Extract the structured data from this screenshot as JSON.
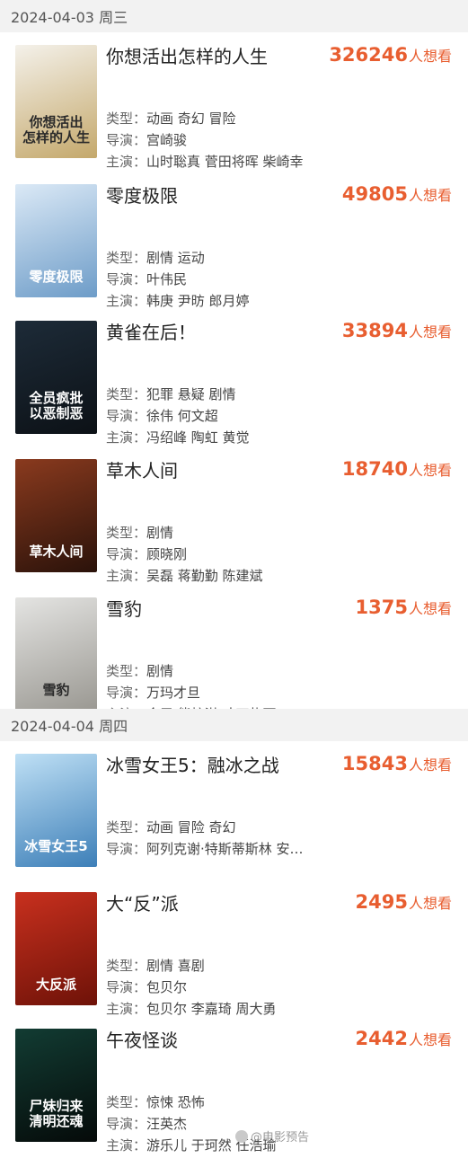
{
  "sections": [
    {
      "date": "2024-04-03 周三",
      "movies": [
        {
          "title": "你想活出怎样的人生",
          "wish_count": "326246",
          "wish_label": "人想看",
          "type_label": "类型：",
          "type": "动画 奇幻 冒险",
          "director_label": "导演：",
          "director": "宫崎骏",
          "cast_label": "主演：",
          "cast": "山时聡真 菅田将晖 柴崎幸",
          "poster_colors": [
            "#f4f1ea",
            "#c4a86b"
          ],
          "poster_text": "你想活出\n怎样的人生"
        },
        {
          "title": "零度极限",
          "wish_count": "49805",
          "wish_label": "人想看",
          "type_label": "类型：",
          "type": "剧情 运动",
          "director_label": "导演：",
          "director": "叶伟民",
          "cast_label": "主演：",
          "cast": "韩庚 尹昉 郎月婷",
          "poster_colors": [
            "#dbe9f6",
            "#6d9cc8"
          ],
          "poster_text": "零度极限"
        },
        {
          "title": "黄雀在后！",
          "wish_count": "33894",
          "wish_label": "人想看",
          "type_label": "类型：",
          "type": "犯罪 悬疑 剧情",
          "director_label": "导演：",
          "director": "徐伟 何文超",
          "cast_label": "主演：",
          "cast": "冯绍峰 陶虹 黄觉",
          "poster_colors": [
            "#1d2b38",
            "#0c1116"
          ],
          "poster_text": "全员疯批\n以恶制恶"
        },
        {
          "title": "草木人间",
          "wish_count": "18740",
          "wish_label": "人想看",
          "type_label": "类型：",
          "type": "剧情",
          "director_label": "导演：",
          "director": "顾晓刚",
          "cast_label": "主演：",
          "cast": "吴磊 蒋勤勤 陈建斌",
          "poster_colors": [
            "#8a3a1e",
            "#2a120a"
          ],
          "poster_text": "草木人间"
        },
        {
          "title": "雪豹",
          "wish_count": "1375",
          "wish_label": "人想看",
          "type_label": "类型：",
          "type": "剧情",
          "director_label": "导演：",
          "director": "万玛才旦",
          "cast_label": "主演：",
          "cast": "金巴 熊梓淇 才丁扎西",
          "poster_colors": [
            "#e4e4e2",
            "#9a9892"
          ],
          "poster_text": "雪豹"
        }
      ]
    },
    {
      "date": "2024-04-04 周四",
      "movies": [
        {
          "title": "冰雪女王5：融冰之战",
          "wish_count": "15843",
          "wish_label": "人想看",
          "type_label": "类型：",
          "type": "动画 冒险 奇幻",
          "director_label": "导演：",
          "director": "阿列克谢·特斯蒂斯林 安…",
          "poster_colors": [
            "#bfe0f5",
            "#3d7fb8"
          ],
          "poster_text": "冰雪女王5"
        },
        {
          "title": "大“反”派",
          "wish_count": "2495",
          "wish_label": "人想看",
          "type_label": "类型：",
          "type": "剧情 喜剧",
          "director_label": "导演：",
          "director": "包贝尔",
          "cast_label": "主演：",
          "cast": "包贝尔 李嘉琦 周大勇",
          "poster_colors": [
            "#c8301e",
            "#6e1208"
          ],
          "poster_text": "大反派"
        },
        {
          "title": "午夜怪谈",
          "wish_count": "2442",
          "wish_label": "人想看",
          "type_label": "类型：",
          "type": "惊悚 恐怖",
          "director_label": "导演：",
          "director": "汪英杰",
          "cast_label": "主演：",
          "cast": "游乐儿 于珂然 任浩瑜",
          "poster_colors": [
            "#123c33",
            "#050a09"
          ],
          "poster_text": "尸妹归来\n清明还魂"
        }
      ]
    }
  ],
  "watermark": "@电影预告"
}
